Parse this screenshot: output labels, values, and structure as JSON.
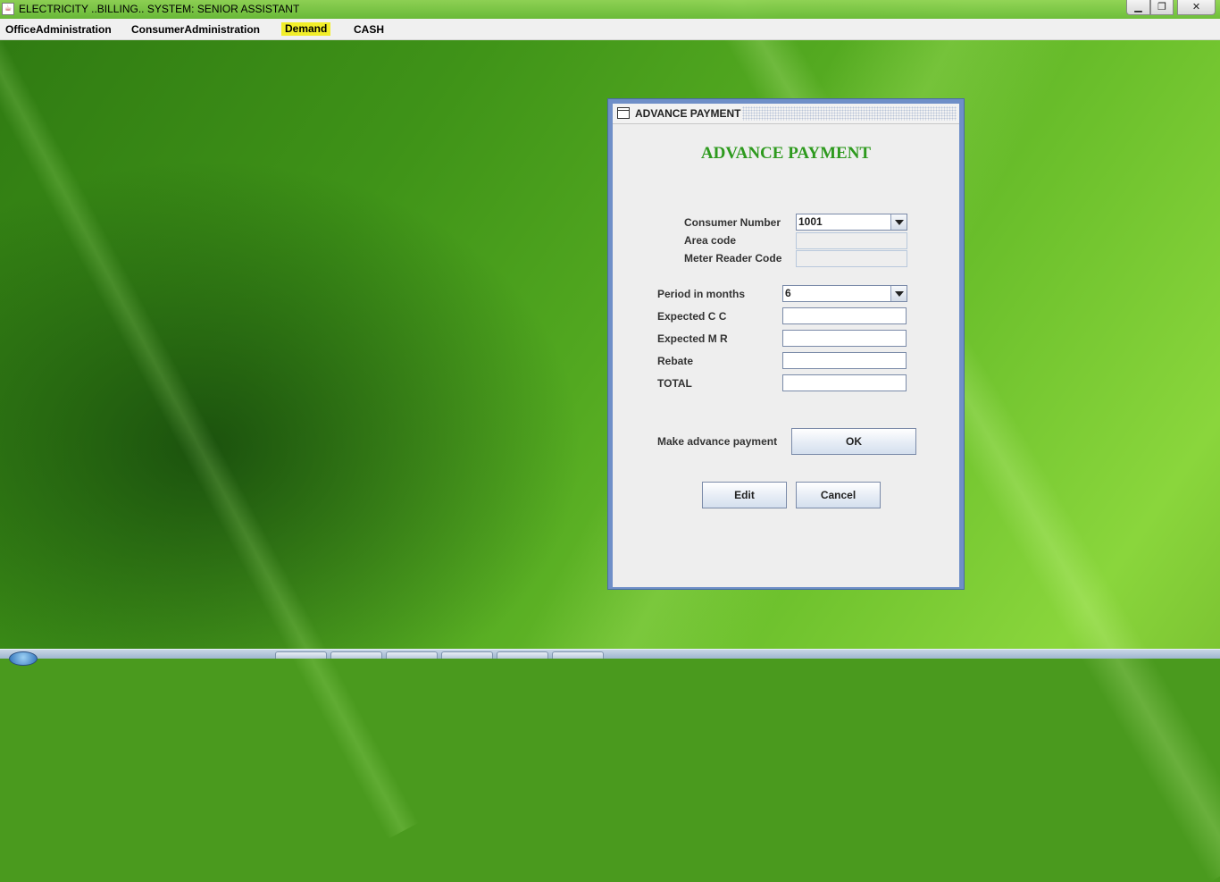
{
  "window": {
    "title": "ELECTRICITY ..BILLING.. SYSTEM: SENIOR ASSISTANT",
    "buttons": {
      "minimize": "▁",
      "maximize": "❐",
      "close": "✕"
    }
  },
  "menu": {
    "items": [
      "OfficeAdministration",
      "ConsumerAdministration",
      "Demand",
      "CASH"
    ],
    "highlighted": "Demand",
    "highlight_color": "#f2ee2a"
  },
  "dialog": {
    "window_title": "ADVANCE PAYMENT",
    "heading": "ADVANCE PAYMENT",
    "heading_color": "#2e9a1e",
    "fields": {
      "consumer_number": {
        "label": "Consumer Number",
        "value": "1001"
      },
      "area_code": {
        "label": "Area code",
        "value": ""
      },
      "meter_reader_code": {
        "label": "Meter Reader Code",
        "value": ""
      },
      "period": {
        "label": "Period in months",
        "value": "6"
      },
      "expected_cc": {
        "label": "Expected C C",
        "value": ""
      },
      "expected_mr": {
        "label": "Expected M R",
        "value": ""
      },
      "rebate": {
        "label": "Rebate",
        "value": ""
      },
      "total": {
        "label": "TOTAL",
        "value": ""
      }
    },
    "make_payment_label": "Make advance payment",
    "buttons": {
      "ok": "OK",
      "edit": "Edit",
      "cancel": "Cancel"
    }
  }
}
